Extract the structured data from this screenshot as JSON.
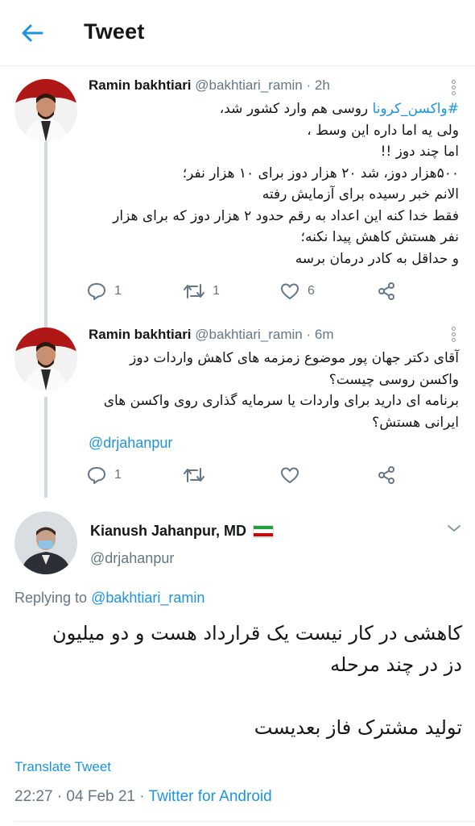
{
  "header": {
    "title": "Tweet"
  },
  "tweets": [
    {
      "name": "Ramin bakhtiari",
      "handle": "@bakhtiari_ramin",
      "time": "2h",
      "hashtag": "#واکسن_کرونا",
      "lines": [
        "روسی هم وارد کشور شد،",
        "ولی یه اما داره این وسط ،",
        "اما چند دوز !!",
        "۵۰۰هزار دوز، شد ۲۰ هزار دوز برای ۱۰ هزار نفر؛",
        "الانم خبر رسیده برای آزمایش رفته",
        "فقط خدا کنه این اعداد به رقم حدود ۲ هزار دوز که برای هزار",
        "نفر هستش کاهش پیدا نکنه؛",
        "و حداقل به کادر درمان برسه"
      ],
      "replies": "1",
      "retweets": "1",
      "likes": "6"
    },
    {
      "name": "Ramin bakhtiari",
      "handle": "@bakhtiari_ramin",
      "time": "6m",
      "lines": [
        "آقای دکتر جهان پور موضوع زمزمه های کاهش واردات دوز",
        "واکسن روسی چیست؟",
        "برنامه ای دارید برای واردات یا سرمایه گذاری روی واکسن های",
        "ایرانی هستش؟"
      ],
      "mention": "@drjahanpur",
      "replies": "1",
      "retweets": "",
      "likes": ""
    }
  ],
  "main_tweet": {
    "name": "Kianush Jahanpur, MD",
    "handle": "@drjahanpur",
    "replying_label": "Replying to",
    "replying_to": "@bakhtiari_ramin",
    "lines": [
      "کاهشی در کار نیست یک قرارداد هست و دو میلیون",
      "دز در چند مرحله",
      "تولید مشترک فاز بعدیست"
    ],
    "translate_label": "Translate Tweet",
    "timestamp": "22:27 · 04 Feb 21 · ",
    "source": "Twitter for Android"
  },
  "colors": {
    "accent": "#1b95e0",
    "muted": "#657786",
    "flag_green": "#239f40",
    "flag_red": "#da0000"
  },
  "icons": [
    "back-arrow-icon",
    "more-vertical-icon",
    "reply-icon",
    "retweet-icon",
    "like-icon",
    "share-icon",
    "chevron-down-icon",
    "iran-flag-icon"
  ]
}
